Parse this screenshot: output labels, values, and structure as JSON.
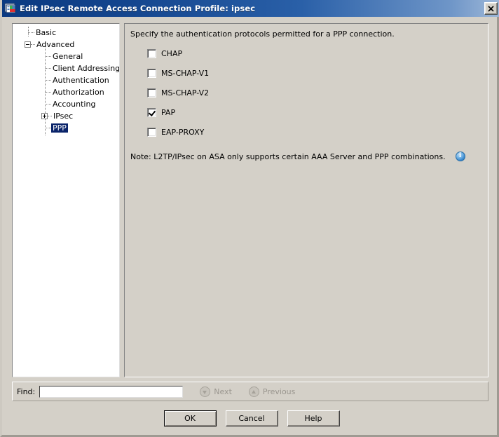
{
  "window": {
    "title": "Edit IPsec Remote Access Connection Profile: ipsec",
    "icon": "application-window-icon",
    "close_label": "✕"
  },
  "tree": {
    "items": [
      {
        "label": "Basic",
        "level": 0,
        "expander": "none",
        "selected": false
      },
      {
        "label": "Advanced",
        "level": 0,
        "expander": "minus",
        "selected": false
      },
      {
        "label": "General",
        "level": 1,
        "expander": "none",
        "selected": false
      },
      {
        "label": "Client Addressing",
        "level": 1,
        "expander": "none",
        "selected": false
      },
      {
        "label": "Authentication",
        "level": 1,
        "expander": "none",
        "selected": false
      },
      {
        "label": "Authorization",
        "level": 1,
        "expander": "none",
        "selected": false
      },
      {
        "label": "Accounting",
        "level": 1,
        "expander": "none",
        "selected": false
      },
      {
        "label": "IPsec",
        "level": 1,
        "expander": "plus",
        "selected": false
      },
      {
        "label": "PPP",
        "level": 1,
        "expander": "none",
        "selected": true
      }
    ]
  },
  "content": {
    "title": "Specify the authentication protocols permitted for a PPP connection.",
    "protocols": [
      {
        "label": "CHAP",
        "checked": false
      },
      {
        "label": "MS-CHAP-V1",
        "checked": false
      },
      {
        "label": "MS-CHAP-V2",
        "checked": false
      },
      {
        "label": "PAP",
        "checked": true
      },
      {
        "label": "EAP-PROXY",
        "checked": false
      }
    ],
    "note": "Note: L2TP/IPsec on ASA only supports certain AAA Server and PPP combinations.",
    "note_icon": "info-icon"
  },
  "find": {
    "label": "Find:",
    "value": "",
    "placeholder": "",
    "next_label": "Next",
    "previous_label": "Previous",
    "next_icon": "arrow-down-circle-icon",
    "previous_icon": "arrow-up-circle-icon"
  },
  "buttons": {
    "ok": "OK",
    "cancel": "Cancel",
    "help": "Help"
  },
  "colors": {
    "title_bar_start": "#0b3a81",
    "title_bar_end": "#9fb8d8",
    "selection": "#0a246a",
    "face": "#d4d0c8",
    "info_blue": "#2f7fc8"
  }
}
